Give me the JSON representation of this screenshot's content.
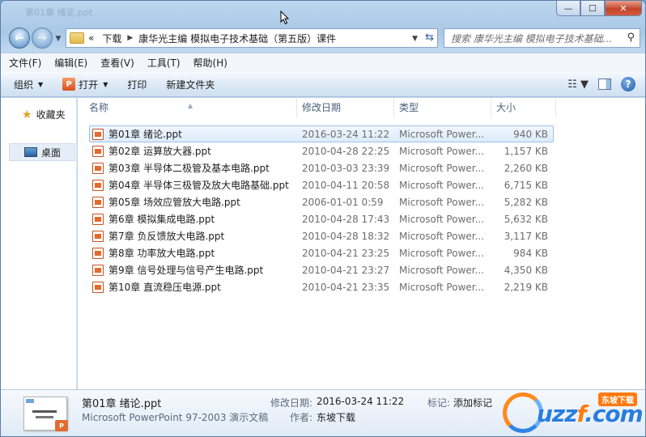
{
  "window": {
    "ghost_title": "第01章 绪论.ppt",
    "controls": {
      "minimize": "—",
      "maximize": "☐",
      "close": "✕"
    }
  },
  "nav": {
    "back_icon": "back-arrow-icon",
    "forward_icon": "forward-arrow-icon",
    "breadcrumb": [
      "«",
      "下载",
      "康华光主编  模拟电子技术基础（第五版）课件"
    ],
    "search_placeholder": "搜索 康华光主编  模拟电子技术基础..."
  },
  "menu": [
    "文件(F)",
    "编辑(E)",
    "查看(V)",
    "工具(T)",
    "帮助(H)"
  ],
  "toolbar": {
    "organize": "组织",
    "open": "打开",
    "print": "打印",
    "new_folder": "新建文件夹"
  },
  "sidebar": {
    "favorites": "收藏夹",
    "desktop": "桌面"
  },
  "columns": {
    "name": "名称",
    "date": "修改日期",
    "type": "类型",
    "size": "大小"
  },
  "files": [
    {
      "name": "第01章 绪论.ppt",
      "date": "2016-03-24 11:22",
      "type": "Microsoft Power...",
      "size": "940 KB"
    },
    {
      "name": "第02章 运算放大器.ppt",
      "date": "2010-04-28 22:25",
      "type": "Microsoft Power...",
      "size": "1,157 KB"
    },
    {
      "name": "第03章 半导体二极管及基本电路.ppt",
      "date": "2010-03-03 23:39",
      "type": "Microsoft Power...",
      "size": "2,260 KB"
    },
    {
      "name": "第04章 半导体三极管及放大电路基础.ppt",
      "date": "2010-04-11 20:58",
      "type": "Microsoft Power...",
      "size": "6,715 KB"
    },
    {
      "name": "第05章 场效应管放大电路.ppt",
      "date": "2006-01-01 0:59",
      "type": "Microsoft Power...",
      "size": "5,282 KB"
    },
    {
      "name": "第6章 模拟集成电路.ppt",
      "date": "2010-04-28 17:43",
      "type": "Microsoft Power...",
      "size": "5,632 KB"
    },
    {
      "name": "第7章 负反馈放大电路.ppt",
      "date": "2010-04-28 18:32",
      "type": "Microsoft Power...",
      "size": "3,117 KB"
    },
    {
      "name": "第8章 功率放大电路.ppt",
      "date": "2010-04-21 23:25",
      "type": "Microsoft Power...",
      "size": "984 KB"
    },
    {
      "name": "第9章 信号处理与信号产生电路.ppt",
      "date": "2010-04-21 23:27",
      "type": "Microsoft Power...",
      "size": "4,350 KB"
    },
    {
      "name": "第10章 直流稳压电源.ppt",
      "date": "2010-04-21 23:35",
      "type": "Microsoft Power...",
      "size": "2,219 KB"
    }
  ],
  "details": {
    "name": "第01章 绪论.ppt",
    "type": "Microsoft PowerPoint 97-2003 演示文稿",
    "modified_label": "修改日期:",
    "modified_value": "2016-03-24 11:22",
    "tags_label": "标记:",
    "tags_value": "添加标记",
    "author_label": "作者:",
    "author_value": "东坡下载"
  },
  "watermark": {
    "text_left": "uzz",
    "text_mid": "f",
    "text_right": ".com",
    "tag": "东坡下载"
  }
}
